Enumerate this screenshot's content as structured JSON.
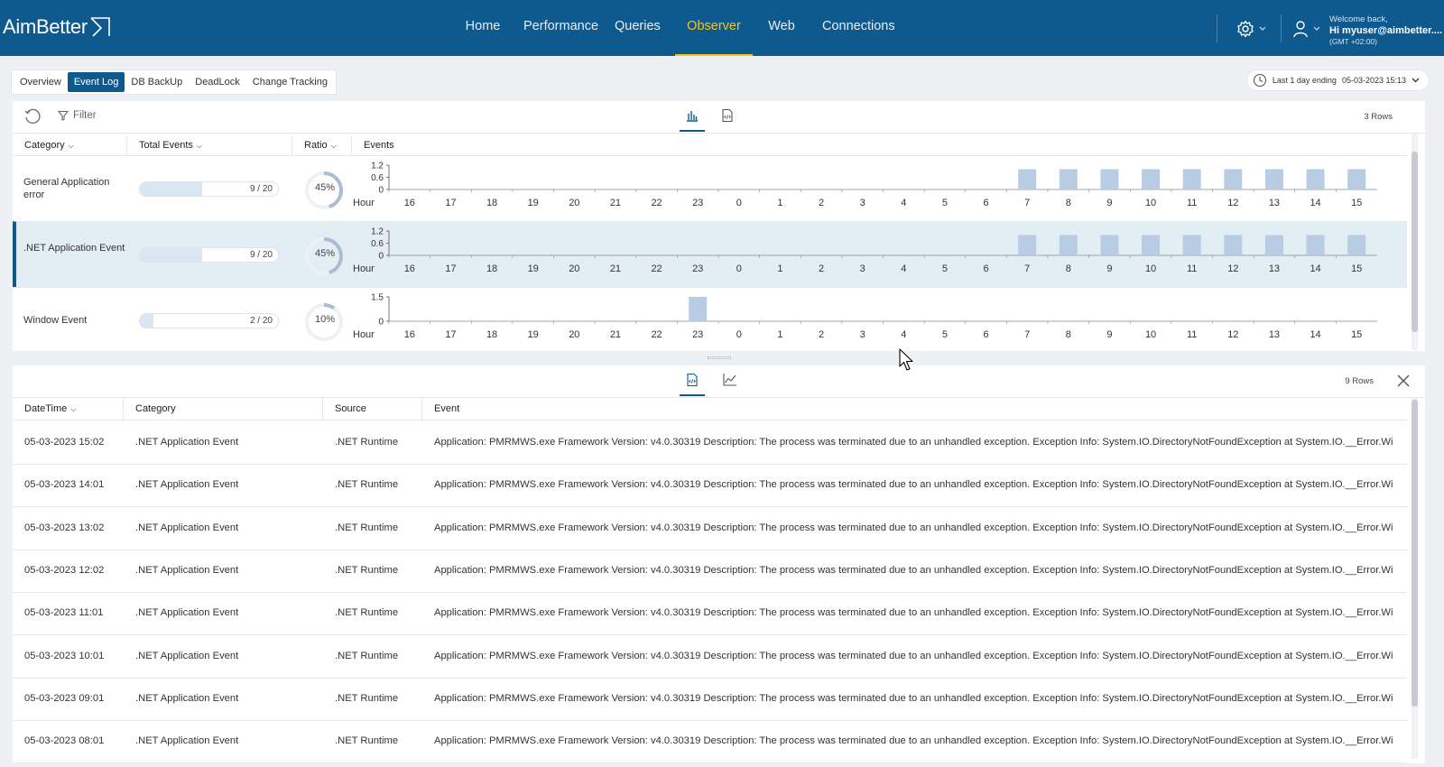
{
  "app": {
    "logo_text": "AimBetter"
  },
  "nav": {
    "items": [
      {
        "label": "Home",
        "active": false
      },
      {
        "label": "Performance",
        "active": false
      },
      {
        "label": "Queries",
        "active": false
      },
      {
        "label": "Observer",
        "active": true
      },
      {
        "label": "Web",
        "active": false
      },
      {
        "label": "Connections",
        "active": false
      }
    ]
  },
  "user": {
    "welcome": "Welcome back,",
    "name": "Hi myuser@aimbetter....",
    "timezone": "(GMT +02:00)",
    "icons": [
      "gear-icon",
      "user-icon",
      "chevron-down-icon"
    ]
  },
  "subtabs": [
    {
      "label": "Overview",
      "active": false
    },
    {
      "label": "Event Log",
      "active": true
    },
    {
      "label": "DB BackUp",
      "active": false
    },
    {
      "label": "DeadLock",
      "active": false
    },
    {
      "label": "Change Tracking",
      "active": false
    }
  ],
  "timerange": {
    "label": "Last 1 day ending",
    "value": "05-03-2023 15:13"
  },
  "upper": {
    "filter_label": "Filter",
    "row_count": "3 Rows",
    "headers": {
      "category": "Category",
      "total": "Total Events",
      "ratio": "Ratio",
      "events": "Events"
    },
    "hour_label": "Hour",
    "hours": [
      "16",
      "17",
      "18",
      "19",
      "20",
      "21",
      "22",
      "23",
      "0",
      "1",
      "2",
      "3",
      "4",
      "5",
      "6",
      "7",
      "8",
      "9",
      "10",
      "11",
      "12",
      "13",
      "14",
      "15"
    ],
    "rows": [
      {
        "category": "General Application error",
        "count": 9,
        "total": 20,
        "count_text": "9 / 20",
        "ratio": 45,
        "ratio_text": "45%",
        "y_ticks": [
          "1.2",
          "0.6",
          "0"
        ],
        "y_max": 1.2,
        "values": [
          0,
          0,
          0,
          0,
          0,
          0,
          0,
          0,
          0,
          0,
          0,
          0,
          0,
          0,
          0,
          1,
          1,
          1,
          1,
          1,
          1,
          1,
          1,
          1
        ],
        "selected": false
      },
      {
        "category": ".NET Application Event",
        "count": 9,
        "total": 20,
        "count_text": "9 / 20",
        "ratio": 45,
        "ratio_text": "45%",
        "y_ticks": [
          "1.2",
          "0.6",
          "0"
        ],
        "y_max": 1.2,
        "values": [
          0,
          0,
          0,
          0,
          0,
          0,
          0,
          0,
          0,
          0,
          0,
          0,
          0,
          0,
          0,
          1,
          1,
          1,
          1,
          1,
          1,
          1,
          1,
          1
        ],
        "selected": true
      },
      {
        "category": "Window Event",
        "count": 2,
        "total": 20,
        "count_text": "2 / 20",
        "ratio": 10,
        "ratio_text": "10%",
        "y_ticks": [
          "1.5",
          "0"
        ],
        "y_max": 1.5,
        "values": [
          0,
          0,
          0,
          0,
          0,
          0,
          0,
          2,
          0,
          0,
          0,
          0,
          0,
          0,
          0,
          0,
          0,
          0,
          0,
          0,
          0,
          0,
          0,
          0
        ],
        "selected": false
      }
    ]
  },
  "lower": {
    "row_count": "9 Rows",
    "headers": {
      "datetime": "DateTime",
      "category": "Category",
      "source": "Source",
      "event": "Event"
    },
    "rows": [
      {
        "datetime": "05-03-2023 15:02",
        "category": ".NET Application Event",
        "source": ".NET Runtime",
        "event": "Application: PMRMWS.exe Framework Version: v4.0.30319 Description: The process was terminated due to an unhandled exception. Exception Info: System.IO.DirectoryNotFoundException at System.IO.__Error.Win..."
      },
      {
        "datetime": "05-03-2023 14:01",
        "category": ".NET Application Event",
        "source": ".NET Runtime",
        "event": "Application: PMRMWS.exe Framework Version: v4.0.30319 Description: The process was terminated due to an unhandled exception. Exception Info: System.IO.DirectoryNotFoundException at System.IO.__Error.Win..."
      },
      {
        "datetime": "05-03-2023 13:02",
        "category": ".NET Application Event",
        "source": ".NET Runtime",
        "event": "Application: PMRMWS.exe Framework Version: v4.0.30319 Description: The process was terminated due to an unhandled exception. Exception Info: System.IO.DirectoryNotFoundException at System.IO.__Error.Win..."
      },
      {
        "datetime": "05-03-2023 12:02",
        "category": ".NET Application Event",
        "source": ".NET Runtime",
        "event": "Application: PMRMWS.exe Framework Version: v4.0.30319 Description: The process was terminated due to an unhandled exception. Exception Info: System.IO.DirectoryNotFoundException at System.IO.__Error.Win..."
      },
      {
        "datetime": "05-03-2023 11:01",
        "category": ".NET Application Event",
        "source": ".NET Runtime",
        "event": "Application: PMRMWS.exe Framework Version: v4.0.30319 Description: The process was terminated due to an unhandled exception. Exception Info: System.IO.DirectoryNotFoundException at System.IO.__Error.Win..."
      },
      {
        "datetime": "05-03-2023 10:01",
        "category": ".NET Application Event",
        "source": ".NET Runtime",
        "event": "Application: PMRMWS.exe Framework Version: v4.0.30319 Description: The process was terminated due to an unhandled exception. Exception Info: System.IO.DirectoryNotFoundException at System.IO.__Error.Win..."
      },
      {
        "datetime": "05-03-2023 09:01",
        "category": ".NET Application Event",
        "source": ".NET Runtime",
        "event": "Application: PMRMWS.exe Framework Version: v4.0.30319 Description: The process was terminated due to an unhandled exception. Exception Info: System.IO.DirectoryNotFoundException at System.IO.__Error.Win..."
      },
      {
        "datetime": "05-03-2023 08:01",
        "category": ".NET Application Event",
        "source": ".NET Runtime",
        "event": "Application: PMRMWS.exe Framework Version: v4.0.30319 Description: The process was terminated due to an unhandled exception. Exception Info: System.IO.DirectoryNotFoundException at System.IO.__Error.Win..."
      }
    ]
  },
  "colors": {
    "brand": "#0e5a8e",
    "active_nav": "#f5c518",
    "bar": "#b8cde3",
    "selected_row": "#e2edf4"
  }
}
